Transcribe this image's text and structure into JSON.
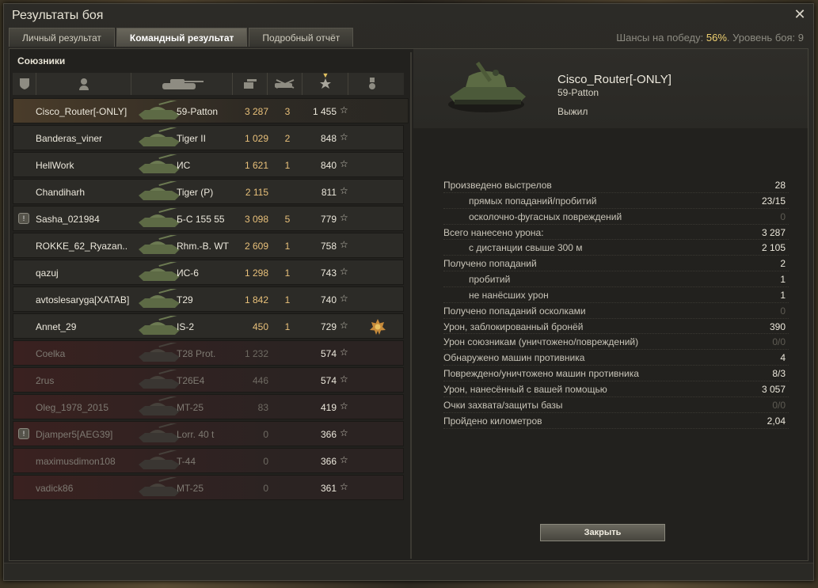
{
  "window": {
    "title": "Результаты боя",
    "close_glyph": "✕"
  },
  "tabs": [
    {
      "label": "Личный результат",
      "active": false
    },
    {
      "label": "Командный результат",
      "active": true
    },
    {
      "label": "Подробный отчёт",
      "active": false
    }
  ],
  "chance": {
    "label": "Шансы на победу:",
    "value": "56%",
    "level_text": ". Уровень боя: 9"
  },
  "team": {
    "title": "Союзники",
    "columns": [
      "clan-icon",
      "player-icon",
      "tank-icon",
      "damage-icon",
      "kills-icon",
      "xp-star-icon",
      "medal-icon"
    ],
    "rows": [
      {
        "name": "Cisco_Router[-ONLY]",
        "tank": "59-Patton",
        "damage": "3 287",
        "kills": "3",
        "xp": "1 455",
        "alive": true,
        "clan": false,
        "medal": false,
        "self": true
      },
      {
        "name": "Banderas_viner",
        "tank": "Tiger II",
        "damage": "1 029",
        "kills": "2",
        "xp": "848",
        "alive": true,
        "clan": false,
        "medal": false
      },
      {
        "name": "HellWork",
        "tank": "ИС",
        "damage": "1 621",
        "kills": "1",
        "xp": "840",
        "alive": true,
        "clan": false,
        "medal": false
      },
      {
        "name": "Chandiharh",
        "tank": "Tiger (P)",
        "damage": "2 115",
        "kills": "",
        "xp": "811",
        "alive": true,
        "clan": false,
        "medal": false
      },
      {
        "name": "Sasha_021984",
        "tank": "Б-С 155 55",
        "damage": "3 098",
        "kills": "5",
        "xp": "779",
        "alive": true,
        "clan": true,
        "medal": false
      },
      {
        "name": "ROKKE_62_Ryazan..",
        "tank": "Rhm.-B. WT",
        "damage": "2 609",
        "kills": "1",
        "xp": "758",
        "alive": true,
        "clan": false,
        "medal": false
      },
      {
        "name": "qazuj",
        "tank": "ИС-6",
        "damage": "1 298",
        "kills": "1",
        "xp": "743",
        "alive": true,
        "clan": false,
        "medal": false
      },
      {
        "name": "avtoslesaryga[XATAB]",
        "tank": "T29",
        "damage": "1 842",
        "kills": "1",
        "xp": "740",
        "alive": true,
        "clan": false,
        "medal": false
      },
      {
        "name": "Annet_29",
        "tank": "IS-2",
        "damage": "450",
        "kills": "1",
        "xp": "729",
        "alive": true,
        "clan": false,
        "medal": true
      },
      {
        "name": "Coelka",
        "tank": "T28 Prot.",
        "damage": "1 232",
        "kills": "",
        "xp": "574",
        "alive": false,
        "clan": false,
        "medal": false
      },
      {
        "name": "2rus",
        "tank": "T26E4",
        "damage": "446",
        "kills": "",
        "xp": "574",
        "alive": false,
        "clan": false,
        "medal": false
      },
      {
        "name": "Oleg_1978_2015",
        "tank": "MT-25",
        "damage": "83",
        "kills": "",
        "xp": "419",
        "alive": false,
        "clan": false,
        "medal": false
      },
      {
        "name": "Djamper5[AEG39]",
        "tank": "Lorr. 40 t",
        "damage": "0",
        "kills": "",
        "xp": "366",
        "alive": false,
        "clan": true,
        "medal": false
      },
      {
        "name": "maximusdimon108",
        "tank": "T-44",
        "damage": "0",
        "kills": "",
        "xp": "366",
        "alive": false,
        "clan": false,
        "medal": false
      },
      {
        "name": "vadick86",
        "tank": "MT-25",
        "damage": "0",
        "kills": "",
        "xp": "361",
        "alive": false,
        "clan": false,
        "medal": false
      }
    ]
  },
  "details": {
    "player": "Cisco_Router[-ONLY]",
    "vehicle": "59-Patton",
    "status": "Выжил",
    "stats": [
      {
        "label": "Произведено выстрелов",
        "value": "28",
        "sub": false,
        "dim": false
      },
      {
        "label": "прямых попаданий/пробитий",
        "value": "23/15",
        "sub": true,
        "dim": false
      },
      {
        "label": "осколочно-фугасных повреждений",
        "value": "0",
        "sub": true,
        "dim": true
      },
      {
        "label": "Всего нанесено урона:",
        "value": "3 287",
        "sub": false,
        "dim": false
      },
      {
        "label": "с дистанции свыше 300 м",
        "value": "2 105",
        "sub": true,
        "dim": false
      },
      {
        "label": "Получено попаданий",
        "value": "2",
        "sub": false,
        "dim": false
      },
      {
        "label": "пробитий",
        "value": "1",
        "sub": true,
        "dim": false
      },
      {
        "label": "не нанёсших урон",
        "value": "1",
        "sub": true,
        "dim": false
      },
      {
        "label": "Получено попаданий осколками",
        "value": "0",
        "sub": false,
        "dim": true
      },
      {
        "label": "Урон, заблокированный бронёй",
        "value": "390",
        "sub": false,
        "dim": false
      },
      {
        "label": "Урон союзникам (уничтожено/повреждений)",
        "value": "0/0",
        "sub": false,
        "dim": true
      },
      {
        "label": "Обнаружено машин противника",
        "value": "4",
        "sub": false,
        "dim": false
      },
      {
        "label": "Повреждено/уничтожено машин противника",
        "value": "8/3",
        "sub": false,
        "dim": false
      },
      {
        "label": "Урон, нанесённый с вашей помощью",
        "value": "3 057",
        "sub": false,
        "dim": false
      },
      {
        "label": "Очки захвата/защиты базы",
        "value": "0/0",
        "sub": false,
        "dim": true
      },
      {
        "label": "Пройдено километров",
        "value": "2,04",
        "sub": false,
        "dim": false
      }
    ],
    "close_label": "Закрыть"
  }
}
